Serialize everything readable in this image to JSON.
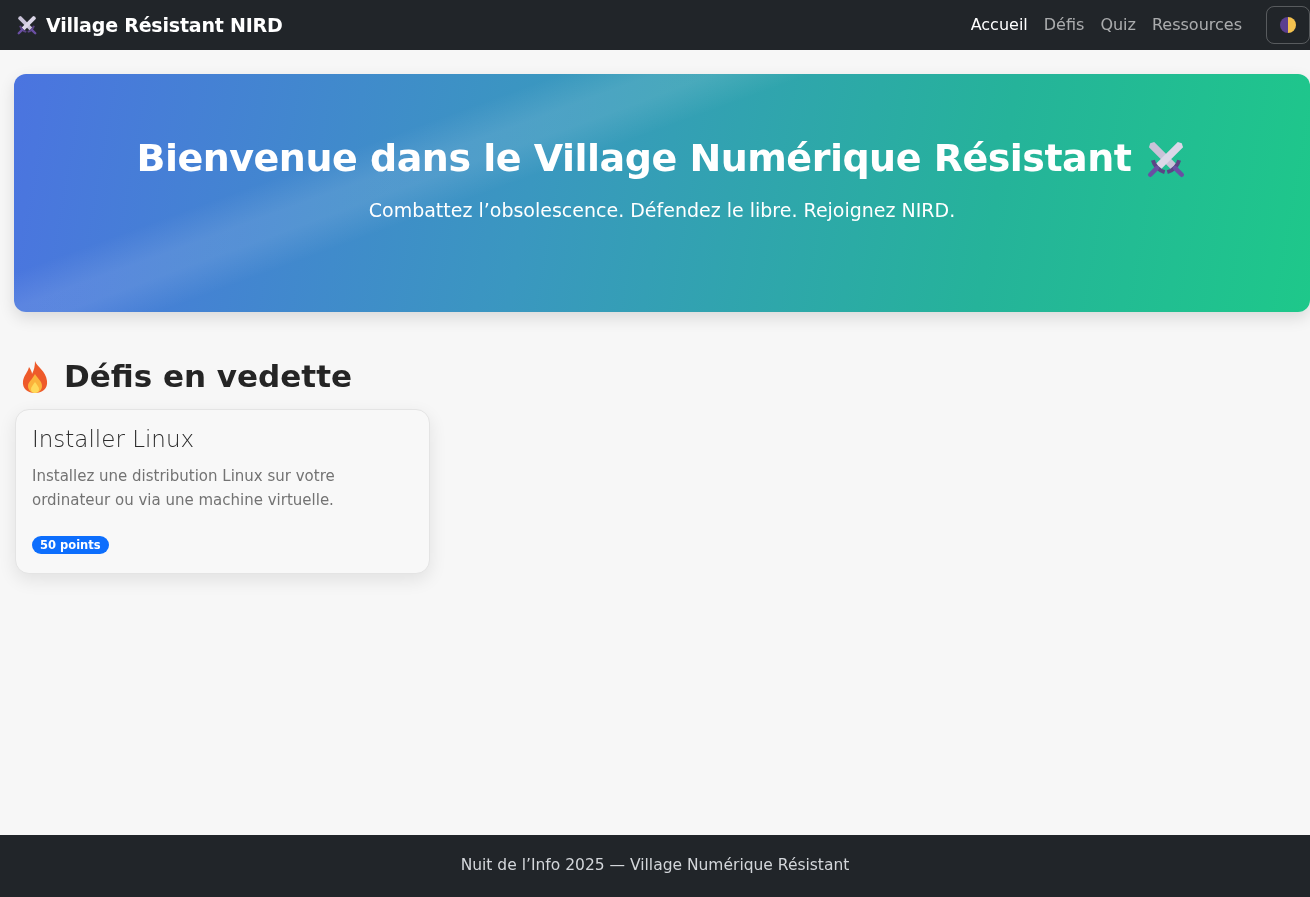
{
  "navbar": {
    "brand": "Village Résistant NIRD",
    "links": [
      {
        "label": "Accueil",
        "selected": true
      },
      {
        "label": "Défis",
        "selected": false
      },
      {
        "label": "Quiz",
        "selected": false
      },
      {
        "label": "Ressources",
        "selected": false
      }
    ]
  },
  "hero": {
    "title": "Bienvenue dans le Village Numérique Résistant",
    "subtitle": "Combattez l’obsolescence. Défendez le libre. Rejoignez NIRD."
  },
  "featured": {
    "heading": "Défis en vedette",
    "challenges": [
      {
        "title": "Installer Linux",
        "description": "Installez une distribution Linux sur votre ordinateur ou via une machine virtuelle.",
        "points": "50 points"
      }
    ]
  },
  "footer": {
    "text": "Nuit de l’Info 2025 — Village Numérique Résistant"
  }
}
